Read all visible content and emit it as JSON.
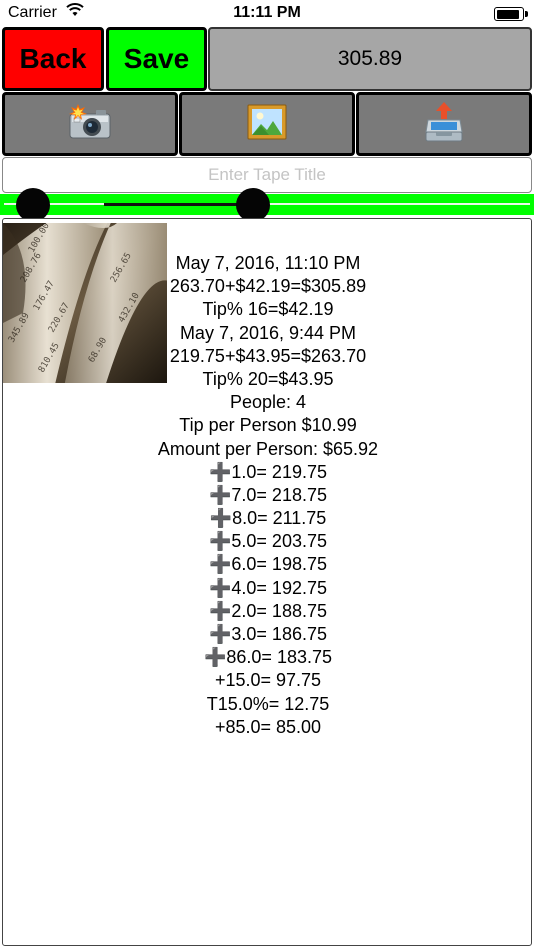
{
  "status_bar": {
    "carrier": "Carrier",
    "time": "11:11 PM"
  },
  "toolbar": {
    "back_label": "Back",
    "save_label": "Save",
    "total_value": "305.89",
    "back_color": "#ff0000",
    "save_color": "#00ff00"
  },
  "tools": [
    {
      "icon": "camera-icon"
    },
    {
      "icon": "photo-library-icon"
    },
    {
      "icon": "export-tray-icon"
    }
  ],
  "title_input": {
    "placeholder": "Enter Tape Title",
    "value": ""
  },
  "range_slider": {
    "accent_color": "#00ff00",
    "low_fraction": 0.06,
    "high_fraction": 0.47
  },
  "tape": {
    "thumbnail_icon": "receipt-tape-photo",
    "lines": [
      "May 7, 2016, 11:10 PM",
      "263.70+$42.19=$305.89",
      "Tip% 16=$42.19",
      "May 7, 2016, 9:44 PM",
      "219.75+$43.95=$263.70",
      "Tip% 20=$43.95",
      "People: 4",
      "Tip per Person $10.99",
      "Amount per Person: $65.92",
      "➕1.0= 219.75",
      "➕7.0= 218.75",
      "➕8.0= 211.75",
      "➕5.0= 203.75",
      "➕6.0= 198.75",
      "➕4.0= 192.75",
      "➕2.0= 188.75",
      "➕3.0= 186.75",
      "➕86.0= 183.75",
      "+15.0= 97.75",
      "T15.0%= 12.75",
      "+85.0= 85.00"
    ]
  }
}
